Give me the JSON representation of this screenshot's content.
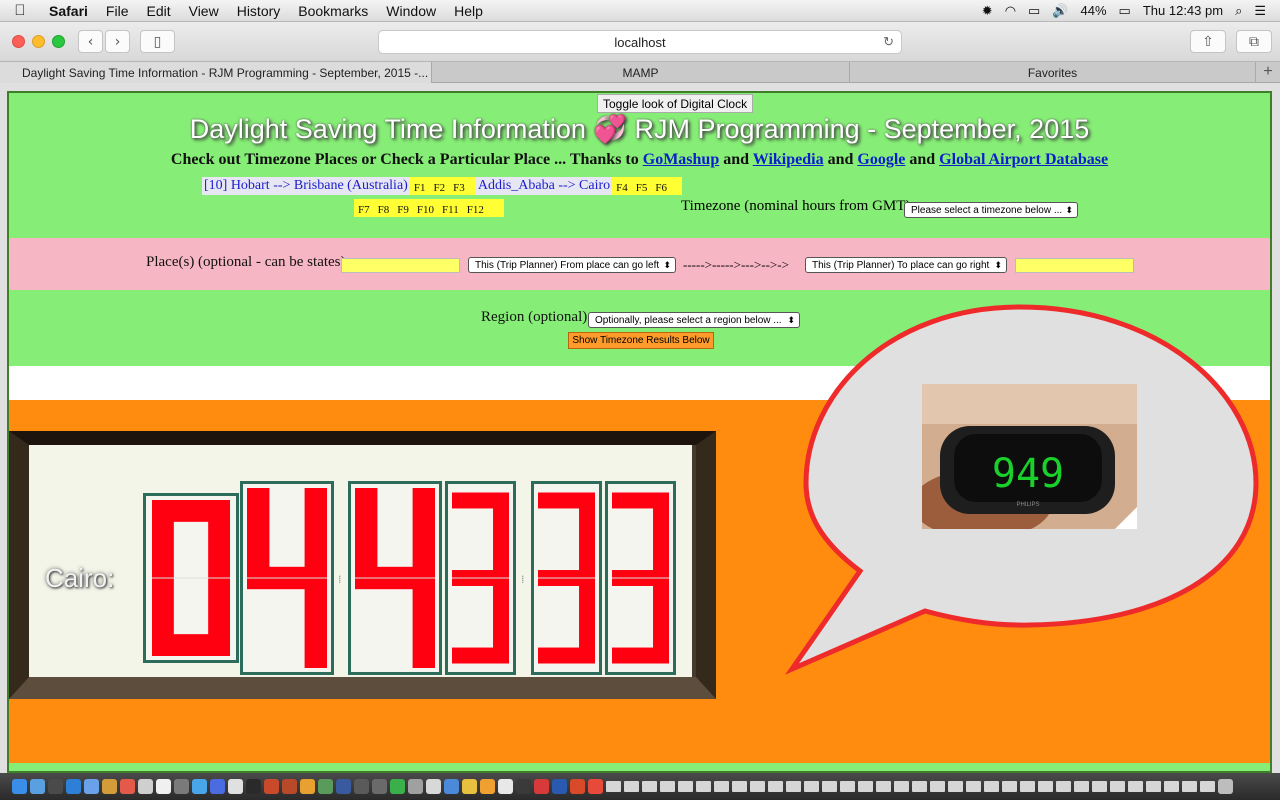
{
  "menubar": {
    "apple": "",
    "items": [
      "Safari",
      "File",
      "Edit",
      "View",
      "History",
      "Bookmarks",
      "Window",
      "Help"
    ],
    "battery": "44%",
    "clock": "Thu 12:43 pm"
  },
  "toolbar": {
    "url": "localhost"
  },
  "tabs": [
    "Daylight Saving Time Information - RJM Programming - September, 2015 -...",
    "MAMP",
    "Favorites"
  ],
  "page": {
    "toggle_button": "Toggle look of Digital Clock",
    "title": "Daylight Saving Time Information 💞 RJM Programming - September, 2015",
    "subtitle_prefix": "Check out Timezone Places or Check a Particular Place ... Thanks to ",
    "links": [
      "GoMashup",
      "Wikipedia",
      "Google",
      "Global Airport Database"
    ],
    "and": "and",
    "fav1": "[10] Hobart --> Brisbane (Australia)",
    "fav2": "Addis_Ababa --> Cairo",
    "fkeys_a": [
      "F1",
      "F2",
      "F3"
    ],
    "fkeys_b": [
      "F4",
      "F5",
      "F6"
    ],
    "fkeys_c": [
      "F7",
      "F8",
      "F9",
      "F10",
      "F11",
      "F12"
    ],
    "timezone_label": "Timezone (nominal hours from GMT):",
    "timezone_select": "Please select a timezone below ...",
    "places_label": "Place(s) (optional - can be states):",
    "from_select": "This (Trip Planner) From place can go left",
    "arrows": "----->----->--->-->->",
    "to_select": "This (Trip Planner) To place can go right",
    "region_label": "Region (optional):",
    "region_select": "Optionally, please select a region below ...",
    "show_button": "Show Timezone Results Below"
  },
  "clock": {
    "city": "Cairo:",
    "digits": [
      "0",
      "4",
      "4",
      "3",
      "3",
      "3"
    ],
    "colors": {
      "segment": "#ff0010",
      "border": "#2d6b5a"
    }
  },
  "photo_clock": {
    "display": "949",
    "brand": "PHILIPS"
  },
  "colors": {
    "green": "#86ee76",
    "pink": "#f7b6c4",
    "orange": "#ff8c0f",
    "bubble_fill": "#e0e0e0",
    "bubble_stroke": "#ee2a2a",
    "link": "#0a1ecc"
  }
}
